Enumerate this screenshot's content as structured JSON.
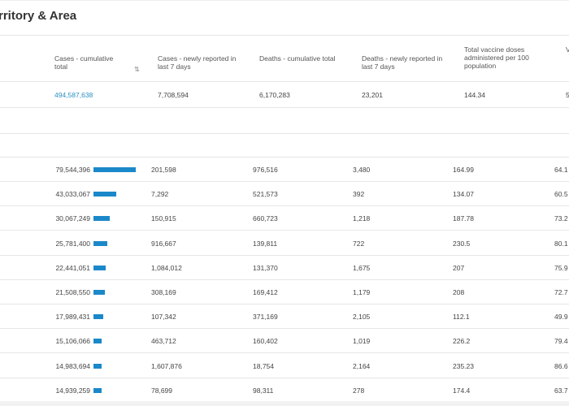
{
  "title": "rritory & Area",
  "columns": [
    "Cases - cumulative total",
    "Cases - newly reported in last 7 days",
    "Deaths - cumulative total",
    "Deaths - newly reported in last 7 days",
    "Total vaccine doses administered per 100 population",
    "V"
  ],
  "sort_icon": "sort-icon",
  "global": {
    "cases_total": "494,587,638",
    "cases_7d": "7,708,594",
    "deaths_total": "6,170,283",
    "deaths_7d": "23,201",
    "vaccine_per_100": "144.34",
    "extra": "5"
  },
  "rows": [
    {
      "cases_total": "79,544,396",
      "bar_fraction": 1.0,
      "cases_7d": "201,598",
      "deaths_total": "976,516",
      "deaths_7d": "3,480",
      "vaccine_per_100": "164.99",
      "extra": "64.1"
    },
    {
      "cases_total": "43,033,067",
      "bar_fraction": 0.54,
      "cases_7d": "7,292",
      "deaths_total": "521,573",
      "deaths_7d": "392",
      "vaccine_per_100": "134.07",
      "extra": "60.5"
    },
    {
      "cases_total": "30,067,249",
      "bar_fraction": 0.38,
      "cases_7d": "150,915",
      "deaths_total": "660,723",
      "deaths_7d": "1,218",
      "vaccine_per_100": "187.78",
      "extra": "73.2"
    },
    {
      "cases_total": "25,781,400",
      "bar_fraction": 0.32,
      "cases_7d": "916,667",
      "deaths_total": "139,811",
      "deaths_7d": "722",
      "vaccine_per_100": "230.5",
      "extra": "80.1"
    },
    {
      "cases_total": "22,441,051",
      "bar_fraction": 0.28,
      "cases_7d": "1,084,012",
      "deaths_total": "131,370",
      "deaths_7d": "1,675",
      "vaccine_per_100": "207",
      "extra": "75.9"
    },
    {
      "cases_total": "21,508,550",
      "bar_fraction": 0.27,
      "cases_7d": "308,169",
      "deaths_total": "169,412",
      "deaths_7d": "1,179",
      "vaccine_per_100": "208",
      "extra": "72.7"
    },
    {
      "cases_total": "17,989,431",
      "bar_fraction": 0.23,
      "cases_7d": "107,342",
      "deaths_total": "371,169",
      "deaths_7d": "2,105",
      "vaccine_per_100": "112.1",
      "extra": "49.9"
    },
    {
      "cases_total": "15,106,066",
      "bar_fraction": 0.19,
      "cases_7d": "463,712",
      "deaths_total": "160,402",
      "deaths_7d": "1,019",
      "vaccine_per_100": "226.2",
      "extra": "79.4"
    },
    {
      "cases_total": "14,983,694",
      "bar_fraction": 0.19,
      "cases_7d": "1,607,876",
      "deaths_total": "18,754",
      "deaths_7d": "2,164",
      "vaccine_per_100": "235.23",
      "extra": "86.6"
    },
    {
      "cases_total": "14,939,259",
      "bar_fraction": 0.19,
      "cases_7d": "78,699",
      "deaths_total": "98,311",
      "deaths_7d": "278",
      "vaccine_per_100": "174.4",
      "extra": "63.7"
    }
  ],
  "colors": {
    "accent": "#1a88c9",
    "link": "#2a8fc4",
    "border": "#e6e6e6"
  }
}
